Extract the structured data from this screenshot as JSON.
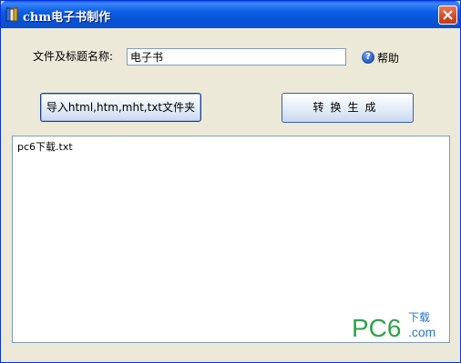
{
  "window": {
    "title": "chm电子书制作",
    "close_icon": "close-icon",
    "app_icon": "book-icon"
  },
  "form": {
    "name_label": "文件及标题名称:",
    "name_value": "电子书",
    "help_icon": "question-icon",
    "help_label": "帮助"
  },
  "buttons": {
    "import_label": "导入html,htm,mht,txt文件夹",
    "convert_label": "转换生成"
  },
  "log": {
    "lines": [
      "pc6下载.txt"
    ]
  },
  "watermark": {
    "text_main": "PC6",
    "text_dot_com": ".com",
    "text_cn": "下载"
  },
  "colors": {
    "titlebar": "#0a58e9",
    "watermark_green": "#2fa24a",
    "watermark_blue": "#2a74c6"
  }
}
